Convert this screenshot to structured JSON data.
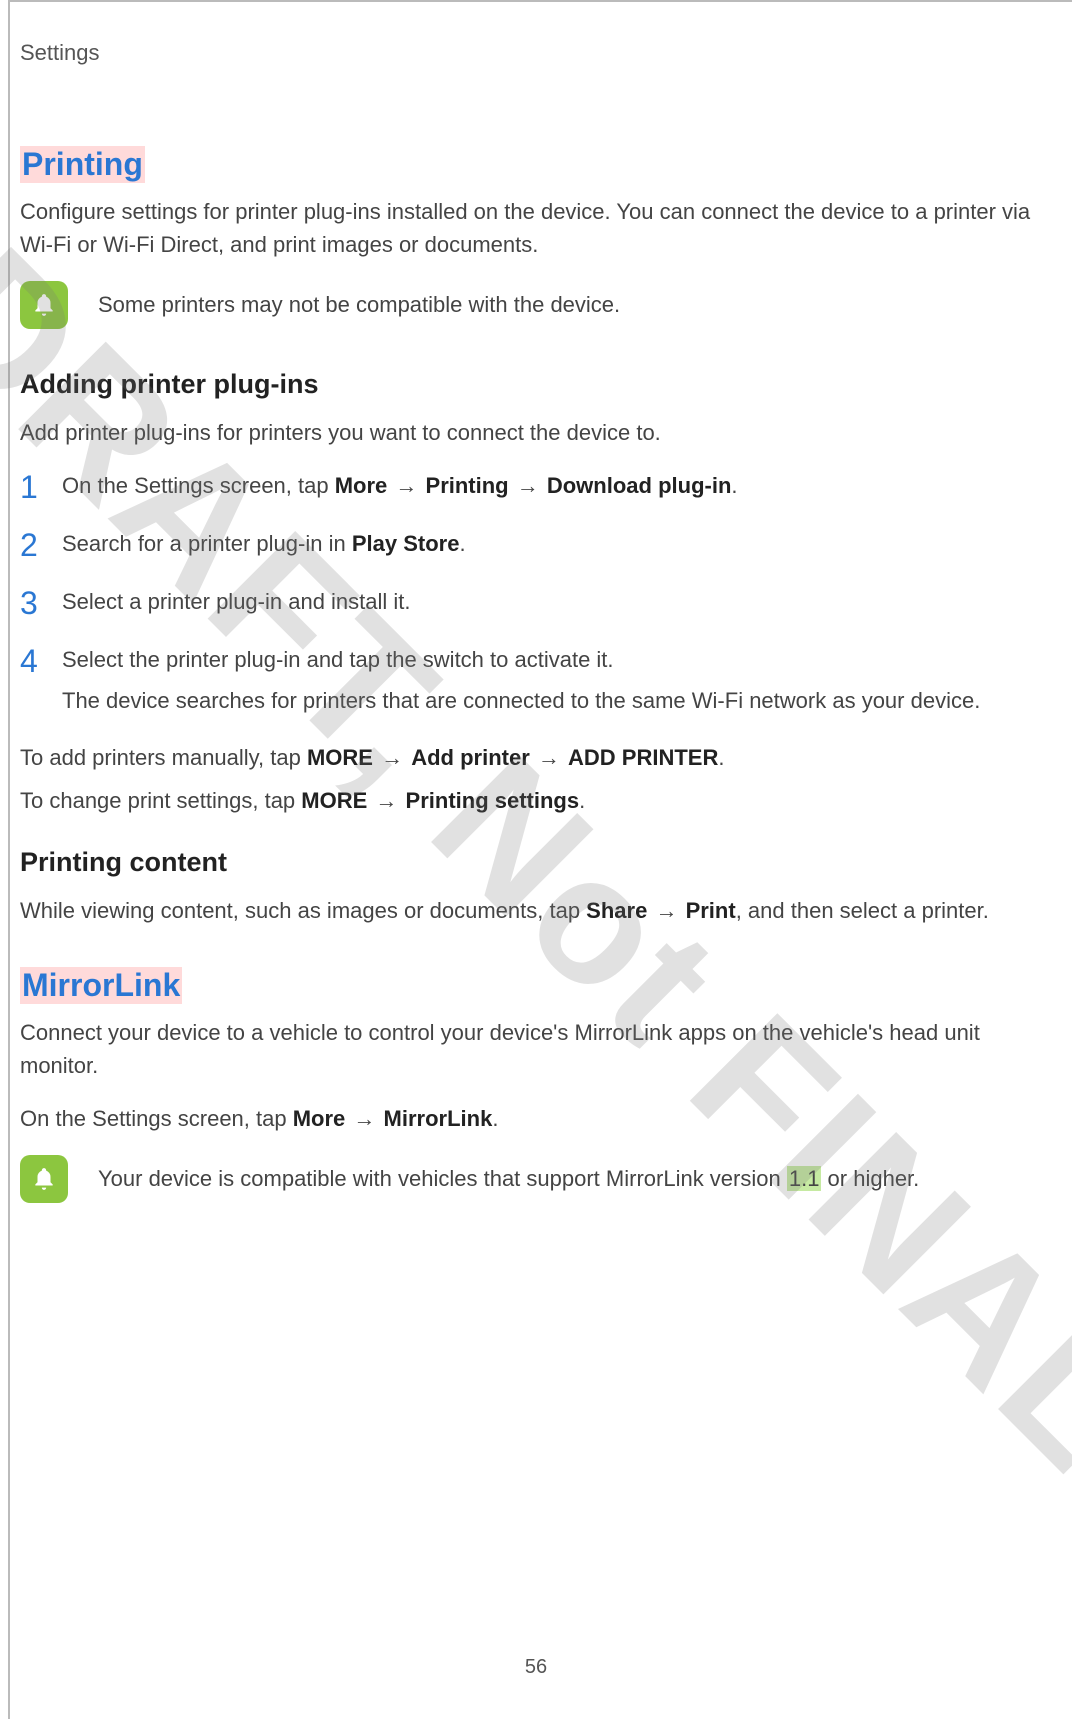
{
  "header": "Settings",
  "page_number": "56",
  "watermark": "DRAFT, Not FINAL",
  "printing": {
    "title": "Printing",
    "intro": "Configure settings for printer plug-ins installed on the device. You can connect the device to a printer via Wi-Fi or Wi-Fi Direct, and print images or documents.",
    "note": "Some printers may not be compatible with the device.",
    "add_heading": "Adding printer plug-ins",
    "add_intro": "Add printer plug-ins for printers you want to connect the device to.",
    "steps": {
      "s1a": "On the Settings screen, tap ",
      "s1_more": "More",
      "s1_arrow1": " → ",
      "s1_printing": "Printing",
      "s1_arrow2": " → ",
      "s1_download": "Download plug-in",
      "s1_end": ".",
      "s2a": "Search for a printer plug-in in ",
      "s2_ps": "Play Store",
      "s2_end": ".",
      "s3": "Select a printer plug-in and install it.",
      "s4": "Select the printer plug-in and tap the switch to activate it.",
      "s4_note": "The device searches for printers that are connected to the same Wi-Fi network as your device."
    },
    "manual_a": "To add printers manually, tap ",
    "manual_more": "MORE",
    "manual_arrow1": " → ",
    "manual_add": "Add printer",
    "manual_arrow2": " → ",
    "manual_addp": "ADD PRINTER",
    "manual_end": ".",
    "change_a": "To change print settings, tap ",
    "change_more": "MORE",
    "change_arrow": " → ",
    "change_ps": "Printing settings",
    "change_end": ".",
    "content_heading": "Printing content",
    "content_a": "While viewing content, such as images or documents, tap ",
    "content_share": "Share",
    "content_arrow": " → ",
    "content_print": "Print",
    "content_end": ", and then select a printer."
  },
  "mirrorlink": {
    "title": "MirrorLink",
    "intro": "Connect your device to a vehicle to control your device's MirrorLink apps on the vehicle's head unit monitor.",
    "nav_a": "On the Settings screen, tap ",
    "nav_more": "More",
    "nav_arrow": " → ",
    "nav_ml": "MirrorLink",
    "nav_end": ".",
    "note_a": "Your device is compatible with vehicles that support MirrorLink version ",
    "note_ver": "1.1",
    "note_end": " or higher."
  }
}
